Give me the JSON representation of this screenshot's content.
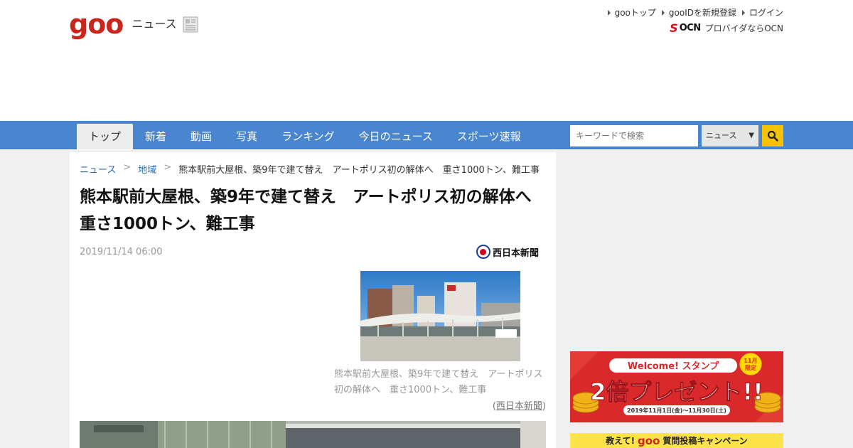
{
  "header": {
    "logo_brand": "goo",
    "logo_section": "ニュース",
    "top_links": [
      "gooトップ",
      "gooIDを新規登録",
      "ログイン"
    ],
    "ocn_brand": "OCN",
    "ocn_text": "プロバイダならOCN"
  },
  "nav": {
    "tabs": [
      "トップ",
      "新着",
      "動画",
      "写真",
      "ランキング",
      "今日のニュース",
      "スポーツ速報"
    ],
    "active_tab": "トップ",
    "search_placeholder": "キーワードで検索",
    "search_scope": "ニュース"
  },
  "article": {
    "breadcrumb": [
      "ニュース",
      "地域",
      "熊本駅前大屋根、築9年で建て替え　アートポリス初の解体へ　重さ1000トン、難工事"
    ],
    "title": "熊本駅前大屋根、築9年で建て替え　アートポリス初の解体へ　重さ1000トン、難工事",
    "date": "2019/11/14 06:00",
    "source_name": "西日本新聞",
    "caption": "熊本駅前大屋根、築9年で建て替え　アートポリス初の解体へ　重さ1000トン、難工事",
    "credit": "西日本新聞"
  },
  "sidebar": {
    "banner1_title": "Welcome! スタンプ",
    "banner1_badge_month": "11月",
    "banner1_badge_word": "限定",
    "banner1_main": "2倍プレゼント!!",
    "banner1_period": "2019年11月1日(金)〜11月30日(土)",
    "banner2_prefix": "教えて!",
    "banner2_brand": "goo",
    "banner2_text": "質問投稿キャンペーン"
  },
  "colors": {
    "nav": "#4a86d0",
    "brand_red": "#c9271d",
    "link": "#2a6ab5",
    "search_button": "#f5c400",
    "banner_red": "#d9292b"
  }
}
